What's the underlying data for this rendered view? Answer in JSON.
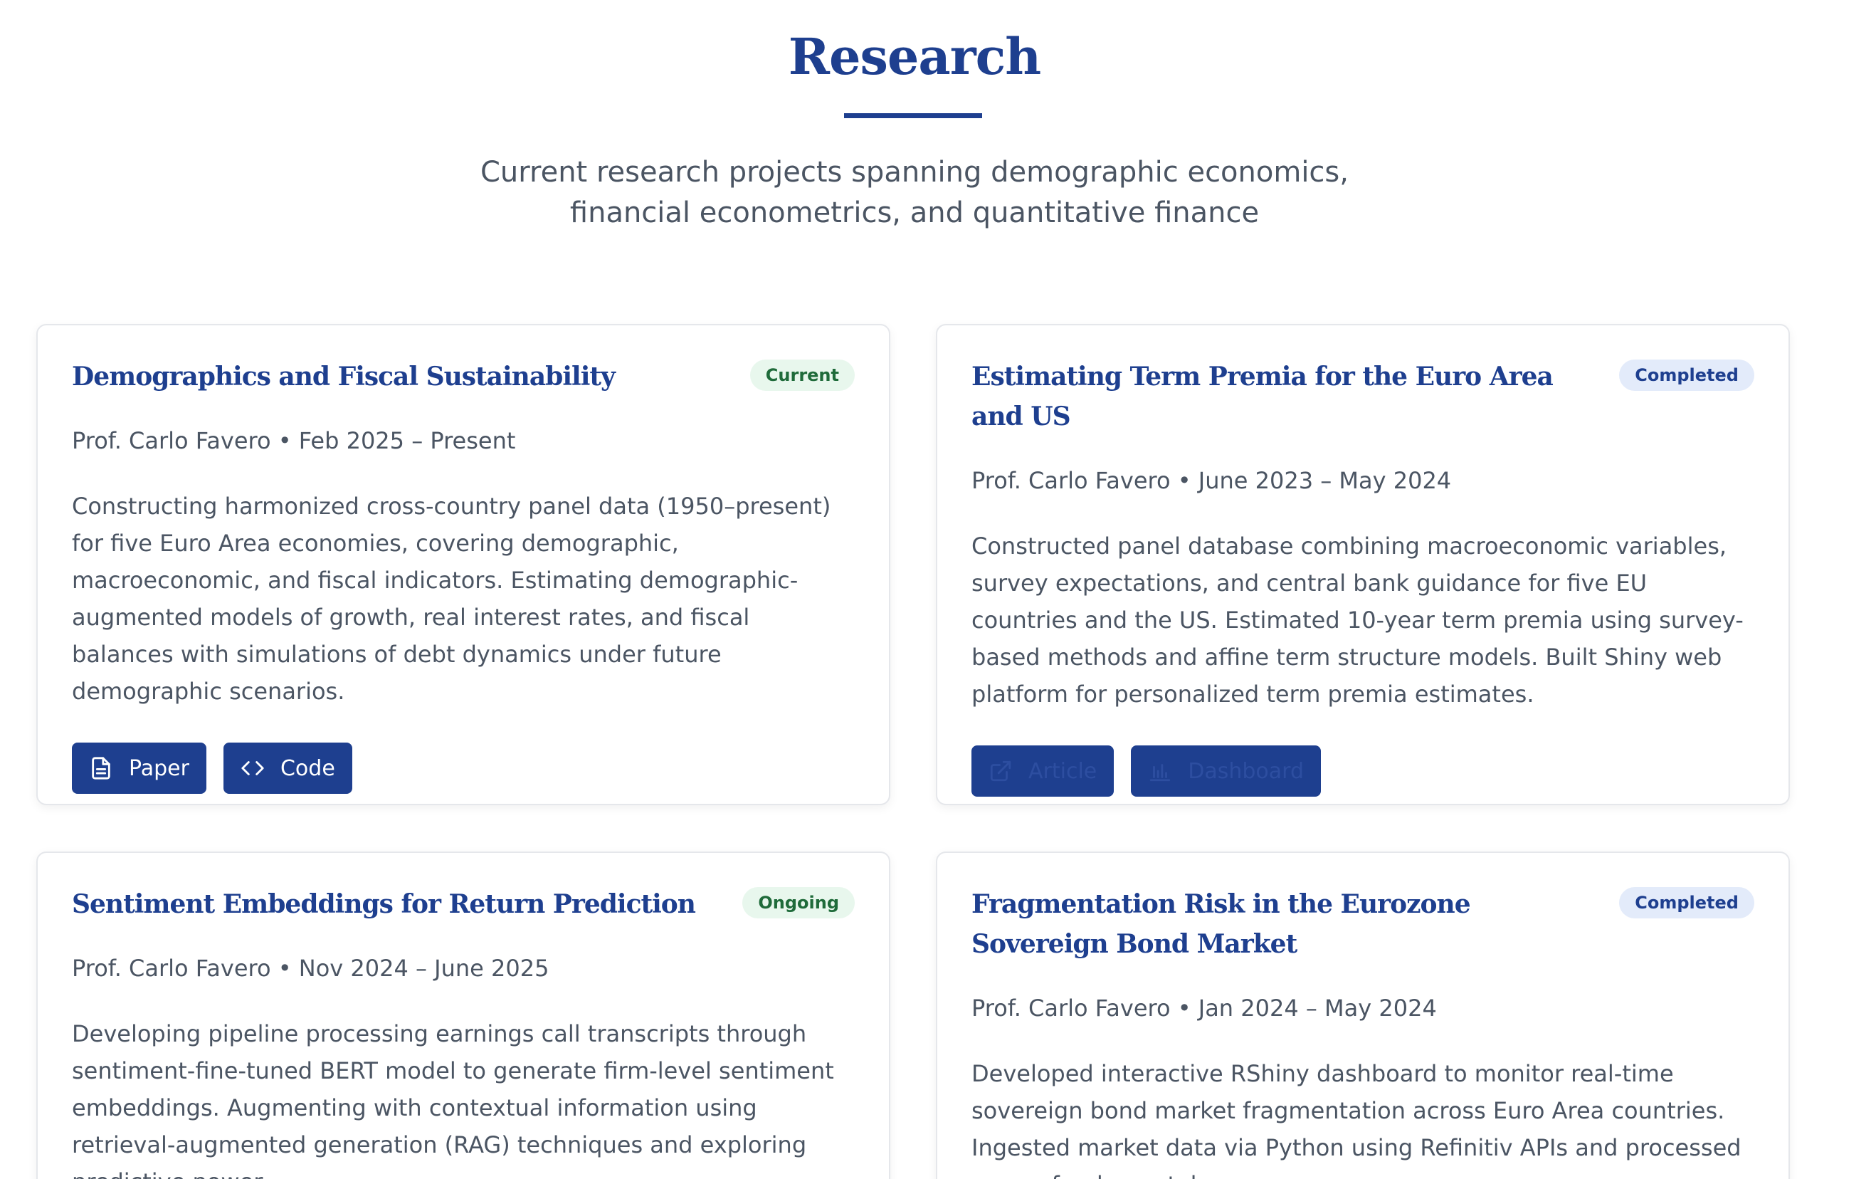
{
  "header": {
    "title": "Research",
    "subtitle": "Current research projects spanning demographic economics, financial econometrics, and quantitative finance"
  },
  "colors": {
    "accent": "#1e3f8f",
    "badge_green_bg": "#e8f7ed",
    "badge_green_text": "#1f6b3a",
    "badge_blue_bg": "#e3ebfa"
  },
  "projects": [
    {
      "title": "Demographics and Fiscal Sustainability",
      "status": "Current",
      "meta": "Prof. Carlo Favero • Feb 2025 – Present",
      "description": "Constructing harmonized cross-country panel data (1950–present) for five Euro Area economies, covering demographic, macroeconomic, and fiscal indicators. Estimating demographic-augmented models of growth, real interest rates, and fiscal balances with simulations of debt dynamics under future demographic scenarios.",
      "buttons": [
        {
          "label": "Paper",
          "icon": "document-icon"
        },
        {
          "label": "Code",
          "icon": "code-icon"
        }
      ]
    },
    {
      "title": "Estimating Term Premia for the Euro Area and US",
      "status": "Completed",
      "meta": "Prof. Carlo Favero • June 2023 – May 2024",
      "description": "Constructed panel database combining macroeconomic variables, survey expectations, and central bank guidance for five EU countries and the US. Estimated 10-year term premia using survey-based methods and affine term structure models. Built Shiny web platform for personalized term premia estimates.",
      "buttons": [
        {
          "label": "Article",
          "icon": "external-link-icon"
        },
        {
          "label": "Dashboard",
          "icon": "bar-chart-icon"
        }
      ]
    },
    {
      "title": "Sentiment Embeddings for Return Prediction",
      "status": "Ongoing",
      "meta": "Prof. Carlo Favero • Nov 2024 – June 2025",
      "description": "Developing pipeline processing earnings call transcripts through sentiment-fine-tuned BERT model to generate firm-level sentiment embeddings. Augmenting with contextual information using retrieval-augmented generation (RAG) techniques and exploring predictive power"
    },
    {
      "title": "Fragmentation Risk in the Eurozone Sovereign Bond Market",
      "status": "Completed",
      "meta": "Prof. Carlo Favero • Jan 2024 – May 2024",
      "description": "Developed interactive RShiny dashboard to monitor real-time sovereign bond market fragmentation across Euro Area countries. Ingested market data via Python using Refinitiv APIs and processed macro-fundamentals"
    }
  ]
}
